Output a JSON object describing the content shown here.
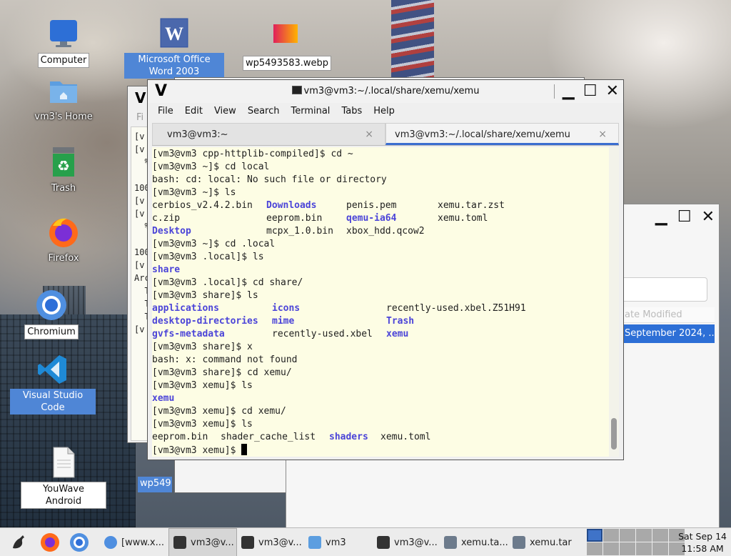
{
  "desktop": {
    "icons": [
      {
        "label": "Computer"
      },
      {
        "label": "Microsoft Office Word 2003"
      },
      {
        "label": "wp5493583.webp"
      },
      {
        "label": "vm3's Home"
      },
      {
        "label": "Trash"
      },
      {
        "label": "Firefox"
      },
      {
        "label": "Chromium"
      },
      {
        "label": "Visual Studio Code"
      },
      {
        "label": "YouWave Android"
      }
    ]
  },
  "back_window": {
    "app_letter": "V",
    "menu_stub": "Fi",
    "lines": [
      "[v",
      "[v",
      "  %",
      "",
      "100",
      "[v",
      "[v",
      "  %",
      "",
      "100",
      "[v",
      "Arc",
      "  T",
      "  T",
      "  T",
      "[v"
    ],
    "bottom_label": "wp549"
  },
  "right_window": {
    "column_header": "ate Modified",
    "selected_value": "September 2024, ..."
  },
  "terminal": {
    "app_letter": "V",
    "title": "vm3@vm3:~/.local/share/xemu/xemu",
    "menu": [
      "File",
      "Edit",
      "View",
      "Search",
      "Terminal",
      "Tabs",
      "Help"
    ],
    "tabs": [
      {
        "label": "vm3@vm3:~",
        "close": "×"
      },
      {
        "label": "vm3@vm3:~/.local/share/xemu/xemu",
        "close": "×"
      }
    ],
    "lines": [
      "[vm3@vm3 cpp-httplib-compiled]$ cd ~",
      "[vm3@vm3 ~]$ cd local",
      "bash: cd: local: No such file or directory",
      "[vm3@vm3 ~]$ ls"
    ],
    "ls_home": [
      [
        "cerbios_v2.4.2.bin",
        "Downloads",
        "penis.pem",
        "xemu.tar.zst"
      ],
      [
        "c.zip",
        "eeprom.bin",
        "qemu-ia64",
        "xemu.toml"
      ],
      [
        "Desktop",
        "mcpx_1.0.bin",
        "xbox_hdd.qcow2",
        ""
      ]
    ],
    "lines2": [
      "[vm3@vm3 ~]$ cd .local",
      "[vm3@vm3 .local]$ ls"
    ],
    "ls_local": "share",
    "lines3": [
      "[vm3@vm3 .local]$ cd share/",
      "[vm3@vm3 share]$ ls"
    ],
    "ls_share": [
      [
        "applications",
        "icons",
        "recently-used.xbel.Z51H91"
      ],
      [
        "desktop-directories",
        "mime",
        "Trash"
      ],
      [
        "gvfs-metadata",
        "recently-used.xbel",
        "xemu"
      ]
    ],
    "lines4": [
      "[vm3@vm3 share]$ x",
      "bash: x: command not found",
      "[vm3@vm3 share]$ cd xemu/",
      "[vm3@vm3 xemu]$ ls"
    ],
    "ls_xemu": "xemu",
    "lines5": [
      "[vm3@vm3 xemu]$ cd xemu/",
      "[vm3@vm3 xemu]$ ls"
    ],
    "ls_final": [
      "eeprom.bin",
      "shader_cache_list",
      "shaders",
      "xemu.toml"
    ],
    "prompt": "[vm3@vm3 xemu]$ "
  },
  "taskbar": {
    "items": [
      {
        "label": "[www.x..."
      },
      {
        "label": "vm3@v..."
      },
      {
        "label": "vm3@v..."
      },
      {
        "label": "vm3"
      },
      {
        "label": "vm3@v..."
      },
      {
        "label": "xemu.ta..."
      },
      {
        "label": "xemu.tar"
      }
    ],
    "clock_date": "Sat Sep 14",
    "clock_time": "11:58 AM"
  },
  "colors": {
    "dir": "#4b44d8",
    "term_bg": "#fdfde4",
    "selection": "#2d6fd6"
  }
}
